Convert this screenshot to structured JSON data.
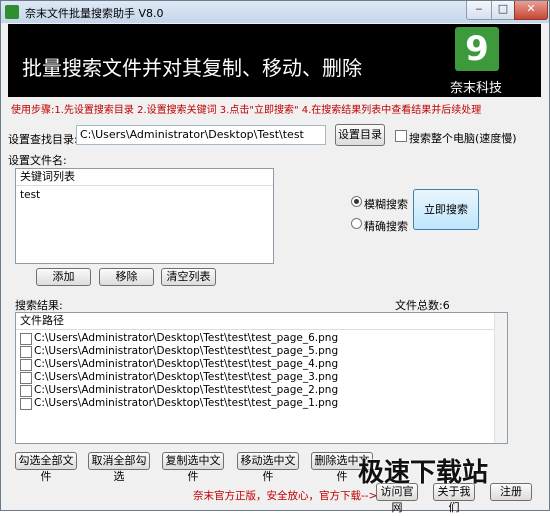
{
  "window": {
    "title": "奈末文件批量搜索助手 V8.0",
    "controls": {
      "minimize": "‒",
      "maximize": "□",
      "close": "✕"
    }
  },
  "banner": {
    "title": "批量搜索文件并对其复制、移动、删除",
    "logo_text": "9",
    "company": "奈末科技"
  },
  "instructions": "使用步骤:1.先设置搜索目录 2.设置搜索关键词 3.点击\"立即搜索\" 4.在搜索结果列表中查看结果并后续处理",
  "directory": {
    "label": "设置查找目录:",
    "value": "C:\\Users\\Administrator\\Desktop\\Test\\test",
    "set_button": "设置目录",
    "whole_pc_label": "搜索整个电脑(速度慢)"
  },
  "filename": {
    "label": "设置文件名:",
    "list_header": "关键词列表",
    "keywords": [
      "test"
    ],
    "add_button": "添加",
    "remove_button": "移除",
    "clear_button": "清空列表"
  },
  "search_mode": {
    "fuzzy_label": "模糊搜索",
    "exact_label": "精确搜索",
    "selected": "fuzzy",
    "search_button": "立即搜索"
  },
  "results": {
    "label": "搜索结果:",
    "count_label": "文件总数:",
    "count": "6",
    "column_header": "文件路径",
    "files": [
      "C:\\Users\\Administrator\\Desktop\\Test\\test\\test_page_6.png",
      "C:\\Users\\Administrator\\Desktop\\Test\\test\\test_page_5.png",
      "C:\\Users\\Administrator\\Desktop\\Test\\test\\test_page_4.png",
      "C:\\Users\\Administrator\\Desktop\\Test\\test\\test_page_3.png",
      "C:\\Users\\Administrator\\Desktop\\Test\\test\\test_page_2.png",
      "C:\\Users\\Administrator\\Desktop\\Test\\test\\test_page_1.png"
    ]
  },
  "actions": {
    "check_all": "勾选全部文件",
    "uncheck_all": "取消全部勾选",
    "copy": "复制选中文件",
    "move": "移动选中文件",
    "delete": "删除选中文件"
  },
  "footer": {
    "note": "奈末官方正版，安全放心，官方下载-->",
    "visit_button": "访问官网",
    "about_button": "关于我们",
    "register_button": "注册"
  },
  "watermark": "极速下载站",
  "colors": {
    "accent_red": "#c00000",
    "banner_bg": "#000000",
    "logo_green": "#3c9a3c"
  }
}
